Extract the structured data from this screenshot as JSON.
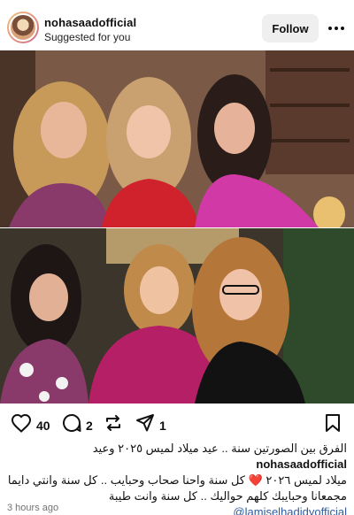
{
  "post": {
    "username": "nohasaadofficial",
    "subtitle": "Suggested for you",
    "follow_label": "Follow",
    "likes": "40",
    "comments": "2",
    "shares": "1",
    "caption_username": "nohasaadofficial",
    "caption_line1": "الفرق بين الصورتين سنة .. عيد ميلاد لميس ٢٠٢٥ وعيد",
    "caption_line2_pre": "ميلاد لميس ٢٠٢٦",
    "caption_heart": "❤️",
    "caption_line2_post": "كل سنة واحنا صحاب وحبايب .. كل سنة وانتي دايما",
    "caption_line3": "مجمعانا وحبايبك كلهم حواليك .. كل سنة وانت طيبة",
    "mention": "@lamiselhadidyofficial",
    "time_ago": "3 hours ago"
  },
  "icons": {
    "more": "more-dots-icon",
    "like": "heart-icon",
    "comment": "comment-icon",
    "repost": "repost-icon",
    "share": "paper-plane-icon",
    "save": "bookmark-icon"
  },
  "colors": {
    "follow_bg": "#efefef",
    "mention": "#2e5a9c",
    "muted": "#737373",
    "heart": "#e0245e"
  }
}
